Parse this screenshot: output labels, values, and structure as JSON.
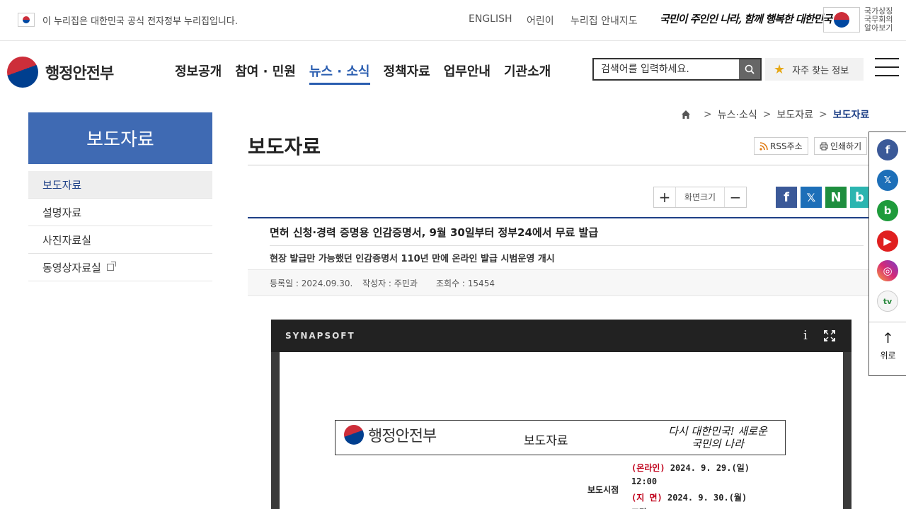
{
  "gov_bar": {
    "notice": "이 누리집은 대한민국 공식 전자정부 누리집입니다.",
    "links": [
      "ENGLISH",
      "어린이",
      "누리집 안내지도"
    ],
    "slogan": "국민이 주인인 나라, 함께 행복한 대한민국",
    "symbol_label": "국가상징 국무회의 알아보기"
  },
  "header": {
    "logo_text": "행정안전부",
    "nav": [
      {
        "label": "정보공개",
        "active": false
      },
      {
        "label": "참여 · 민원",
        "active": false
      },
      {
        "label": "뉴스 · 소식",
        "active": true
      },
      {
        "label": "정책자료",
        "active": false
      },
      {
        "label": "업무안내",
        "active": false
      },
      {
        "label": "기관소개",
        "active": false
      }
    ],
    "search_placeholder": "검색어를 입력하세요.",
    "search_icon": "search-icon",
    "frequent_label": "자주 찾는 정보"
  },
  "sidebar": {
    "title": "보도자료",
    "items": [
      {
        "label": "보도자료",
        "active": true
      },
      {
        "label": "설명자료",
        "active": false
      },
      {
        "label": "사진자료실",
        "active": false
      },
      {
        "label": "동영상자료실",
        "active": false,
        "external": true
      }
    ]
  },
  "breadcrumb": {
    "items": [
      "뉴스·소식",
      "보도자료",
      "보도자료"
    ]
  },
  "page": {
    "title": "보도자료",
    "rss_label": "RSS주소",
    "print_label": "인쇄하기",
    "zoom_label": "화면크기"
  },
  "share_icons": [
    "facebook-icon",
    "x-icon",
    "naver-blog-icon",
    "band-icon"
  ],
  "article": {
    "title": "면허 신청·경력 증명용 인감증명서, 9월 30일부터 정부24에서 무료 발급",
    "subtitle": "현장 발급만 가능했던 인감증명서 110년 만에 온라인 발급 시범운영 개시",
    "meta_date": "등록일 : 2024.09.30.",
    "meta_author": "작성자 : 주민과",
    "meta_views": "조회수 : 15454"
  },
  "viewer": {
    "brand": "SYNAPSOFT",
    "info_glyph": "i",
    "doc_logo": "행정안전부",
    "doc_type": "보도자료",
    "doc_slogan": "다시 대한민국! 새로운 국민의 나라",
    "release_label": "보도시점",
    "online_tag": "(온라인)",
    "online_time": "2024. 9. 29.(일)",
    "online_hour": "12:00",
    "print_tag": "(지  면)",
    "print_time": "2024. 9. 30.(월)",
    "print_more": "조간"
  },
  "quick_rail": {
    "icons": [
      "facebook-icon",
      "x-icon",
      "blog-icon",
      "youtube-icon",
      "instagram-icon",
      "tv-icon"
    ],
    "top_label": "위로"
  },
  "colors": {
    "primary": "#3f6ab3",
    "nav_active": "#2a5db0",
    "accent_red": "#c0001a"
  }
}
